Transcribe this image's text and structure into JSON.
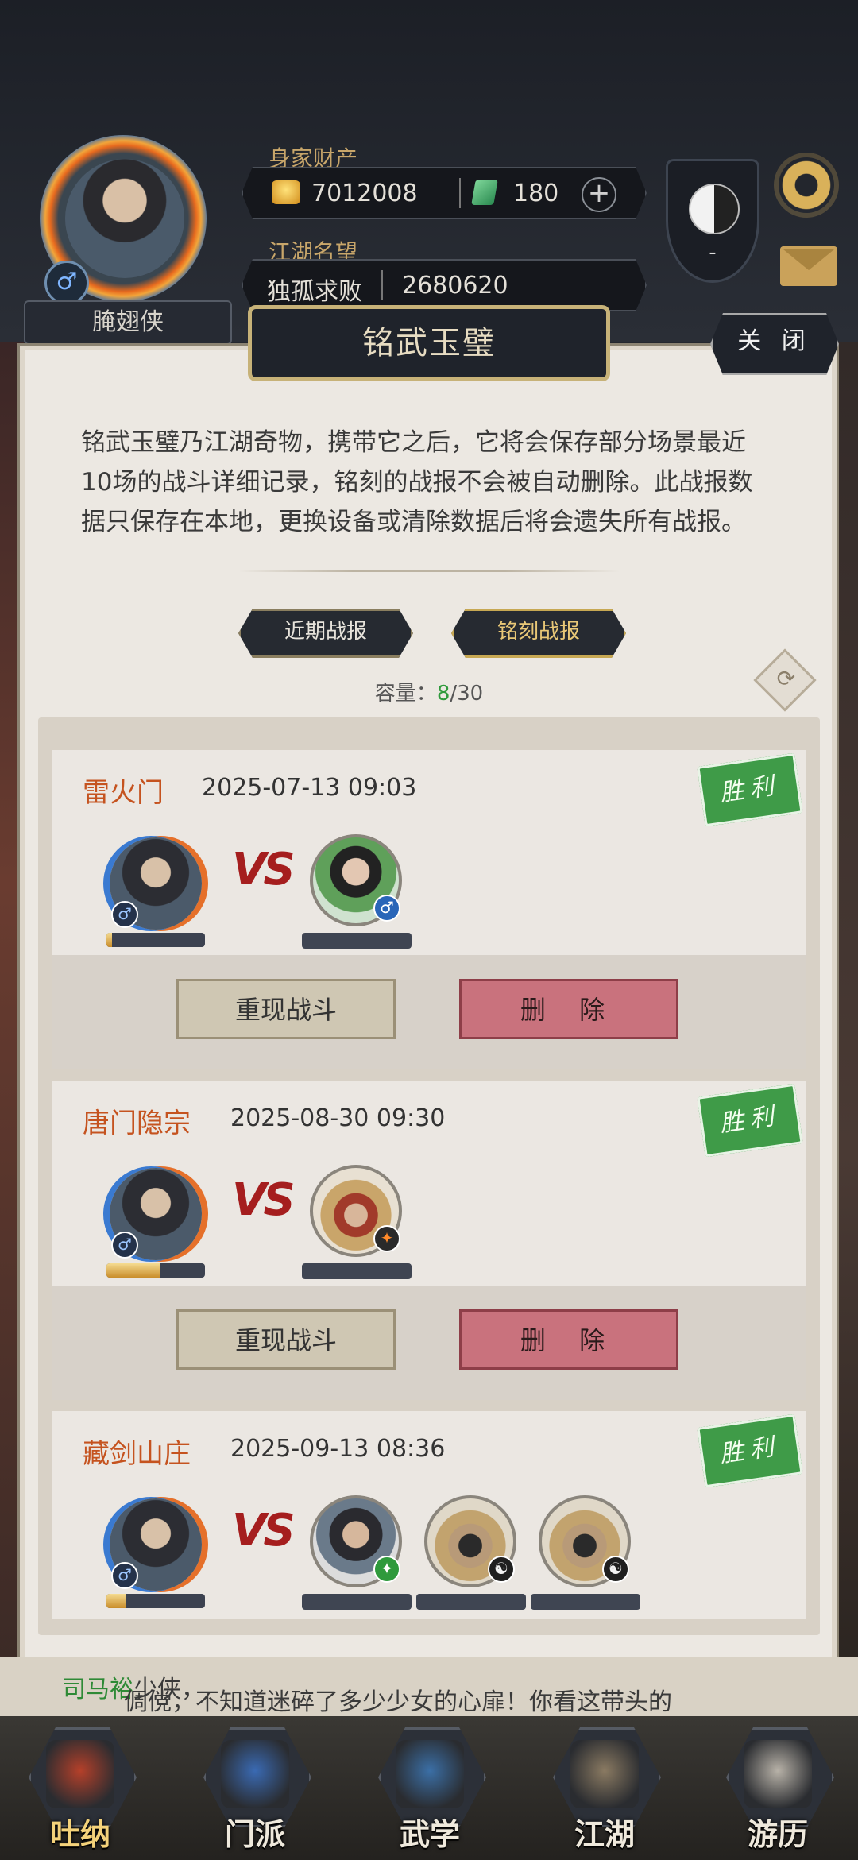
{
  "profile": {
    "name": "腌翅侠",
    "gender_symbol": "♂",
    "wealth_label": "身家财产",
    "gold": "7012008",
    "jade": "180",
    "plus_symbol": "+",
    "reputation_label": "江湖名望",
    "reputation_title": "独孤求败",
    "reputation_value": "2680620",
    "badge_dash": "-"
  },
  "dialog": {
    "title": "铭武玉璧",
    "close_label": "关 闭",
    "description": "铭武玉璧乃江湖奇物，携带它之后，它将会保存部分场景最近10场的战斗详细记录，铭刻的战报不会被自动删除。此战报数据只保存在本地，更换设备或清除数据后将会遗失所有战报。",
    "tabs": [
      {
        "label": "近期战报",
        "active": false
      },
      {
        "label": "铭刻战报",
        "active": true
      }
    ],
    "capacity_label": "容量：",
    "capacity_current": "8",
    "capacity_max": "/30",
    "refresh_symbol": "⟳"
  },
  "battles": [
    {
      "sect": "雷火门",
      "datetime": "2025-07-13 09:03",
      "result": "胜利",
      "vs": "VS",
      "player_hp": 0.06,
      "replay": "重现战斗",
      "delete": "删 除",
      "enemies": [
        {
          "look": "e-girl",
          "badge": "blue",
          "badge_symbol": "♂"
        }
      ]
    },
    {
      "sect": "唐门隐宗",
      "datetime": "2025-08-30 09:30",
      "result": "胜利",
      "vs": "VS",
      "player_hp": 0.55,
      "replay": "重现战斗",
      "delete": "删 除",
      "enemies": [
        {
          "look": "e-straw",
          "badge": "orange",
          "badge_symbol": "✦"
        }
      ]
    },
    {
      "sect": "藏剑山庄",
      "datetime": "2025-09-13 08:36",
      "result": "胜利",
      "vs": "VS",
      "player_hp": 0.2,
      "enemies": [
        {
          "look": "e-warrior",
          "badge": "green",
          "badge_symbol": "✦"
        },
        {
          "look": "e-masked",
          "badge": "taiji",
          "badge_symbol": "☯"
        },
        {
          "look": "e-masked",
          "badge": "taiji",
          "badge_symbol": "☯"
        }
      ]
    }
  ],
  "story": {
    "prefix": "倜傥，不知道迷碎了多少少女的心扉！你看这带头的",
    "highlight": "司马裕",
    "suffix": "少侠，"
  },
  "bottom_nav": [
    {
      "label": "吐纳",
      "icon": "meditation-icon",
      "color": "#b5402a"
    },
    {
      "label": "门派",
      "icon": "sect-icon",
      "color": "#3a6ab3"
    },
    {
      "label": "武学",
      "icon": "martial-book-icon",
      "color": "#3b6fa6"
    },
    {
      "label": "江湖",
      "icon": "jianghu-icon",
      "color": "#8a7a62"
    },
    {
      "label": "游历",
      "icon": "horse-icon",
      "color": "#b8b2a8"
    }
  ]
}
